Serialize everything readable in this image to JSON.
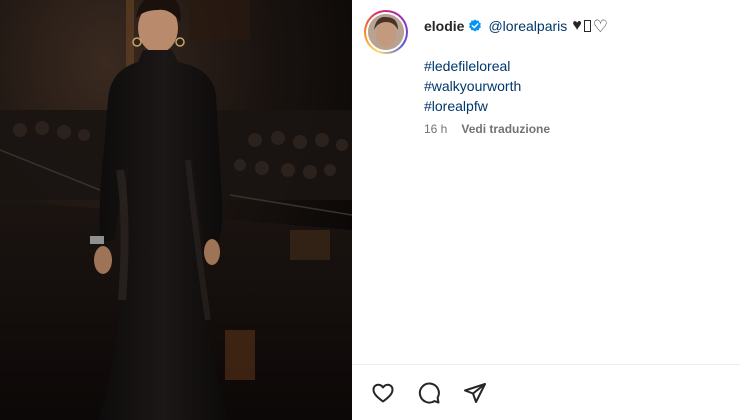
{
  "post": {
    "username": "elodie",
    "mention": "@lorealparis",
    "hashtags": [
      "#ledefileloreal",
      "#walkyourworth",
      "#lorealpfw"
    ],
    "time_ago": "16 h",
    "translate_label": "Vedi traduzione"
  },
  "icons": {
    "verified": "verified-badge-icon",
    "emoji_1": "black-heart-emoji",
    "emoji_2": "missing-glyph-emoji",
    "emoji_3": "white-heart-emoji",
    "like": "heart-outline-icon",
    "comment": "comment-bubble-icon",
    "share": "paper-plane-icon"
  },
  "colors": {
    "verified_blue": "#0095f6",
    "link_blue": "#00376b",
    "secondary_text": "#737373"
  }
}
